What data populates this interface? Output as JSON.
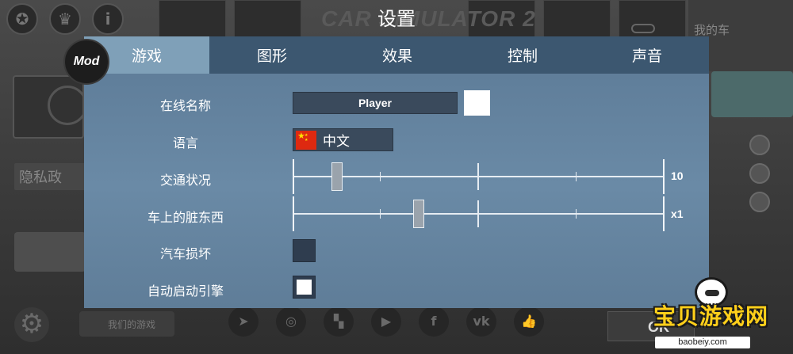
{
  "dialog": {
    "title": "设置"
  },
  "tabs": [
    {
      "label": "游戏",
      "active": true
    },
    {
      "label": "图形",
      "active": false
    },
    {
      "label": "效果",
      "active": false
    },
    {
      "label": "控制",
      "active": false
    },
    {
      "label": "声音",
      "active": false
    }
  ],
  "mod_badge": "Mod",
  "settings": {
    "online_name": {
      "label": "在线名称",
      "value": "Player",
      "color_swatch": "#ffffff"
    },
    "language": {
      "label": "语言",
      "value": "中文",
      "flag_icon": "china-flag-icon"
    },
    "traffic": {
      "label": "交通状况",
      "value_text": "10",
      "position_fraction": 0.12
    },
    "car_dirt": {
      "label": "车上的脏东西",
      "value_text": "x1",
      "position_fraction": 0.34
    },
    "car_damage": {
      "label": "汽车损坏",
      "checked": false
    },
    "auto_start_engine": {
      "label": "自动启动引擎",
      "checked": true
    }
  },
  "background": {
    "logo": "CAR SIMULATOR 2",
    "my_car_label": "我的车",
    "privacy_label": "隐私政",
    "our_games_label": "我们的游戏",
    "ok_label": "OK",
    "info_icon": "i",
    "social_icons": [
      "telegram-icon",
      "instagram-icon",
      "twitch-icon",
      "youtube-icon",
      "facebook-icon",
      "vk-icon",
      "like-icon"
    ]
  },
  "watermark": {
    "text": "宝贝游戏网",
    "url": "baobeiy.com"
  },
  "colors": {
    "panel": "#6a8aa6",
    "tab_bar": "#3c5770",
    "tab_active": "#7fa0b8",
    "watermark_text": "#ffcf1a"
  }
}
